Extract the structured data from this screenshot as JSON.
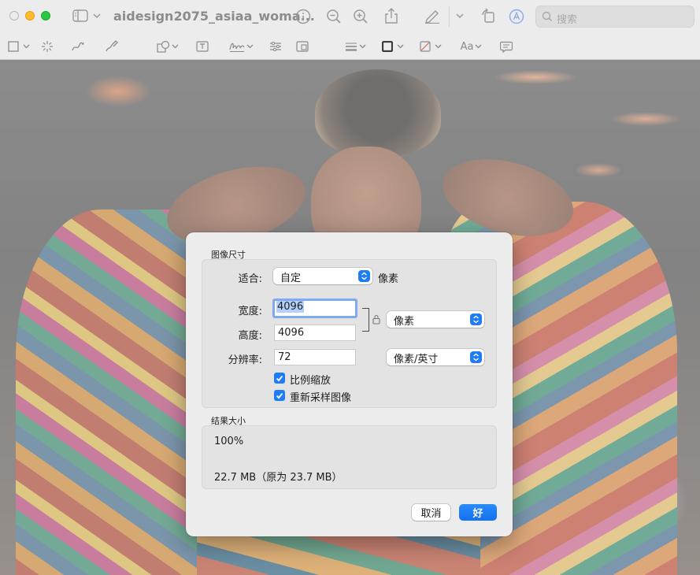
{
  "window": {
    "title": "aidesign2075_asiaa_woma..."
  },
  "search": {
    "placeholder": "搜索"
  },
  "toolbar": {
    "font_button_label": "Aa"
  },
  "dialog": {
    "image_size_section": "图像尺寸",
    "fit_label": "适合:",
    "fit_value": "自定",
    "fit_unit": "像素",
    "width_label": "宽度:",
    "width_value": "4096",
    "height_label": "高度:",
    "height_value": "4096",
    "dimension_unit": "像素",
    "resolution_label": "分辨率:",
    "resolution_value": "72",
    "resolution_unit": "像素/英寸",
    "scale_proportionally": "比例缩放",
    "scale_proportionally_checked": true,
    "resample_image": "重新采样图像",
    "resample_image_checked": true,
    "result_section": "结果大小",
    "result_percent": "100%",
    "result_size": "22.7 MB（原为 23.7 MB）",
    "cancel_label": "取消",
    "ok_label": "好"
  },
  "colors": {
    "accent": "#1f7cf7",
    "focus_ring": "#7fa9f1",
    "dialog_bg": "#ececec"
  },
  "icons": [
    "sidebar-toggle-icon",
    "chevron-down-icon",
    "info-icon",
    "zoom-out-icon",
    "zoom-in-icon",
    "share-icon",
    "markup-pen-icon",
    "rotate-icon",
    "annotate-circle-icon",
    "search-icon",
    "rect-select-icon",
    "instant-alpha-icon",
    "sketch-icon",
    "draw-icon",
    "shapes-icon",
    "text-box-icon",
    "signature-icon",
    "adjust-color-icon",
    "adjust-size-icon",
    "line-style-icon",
    "border-color-icon",
    "fill-color-icon",
    "font-icon",
    "speech-bubble-icon",
    "lock-icon",
    "checkmark-icon",
    "updown-arrows-icon"
  ]
}
